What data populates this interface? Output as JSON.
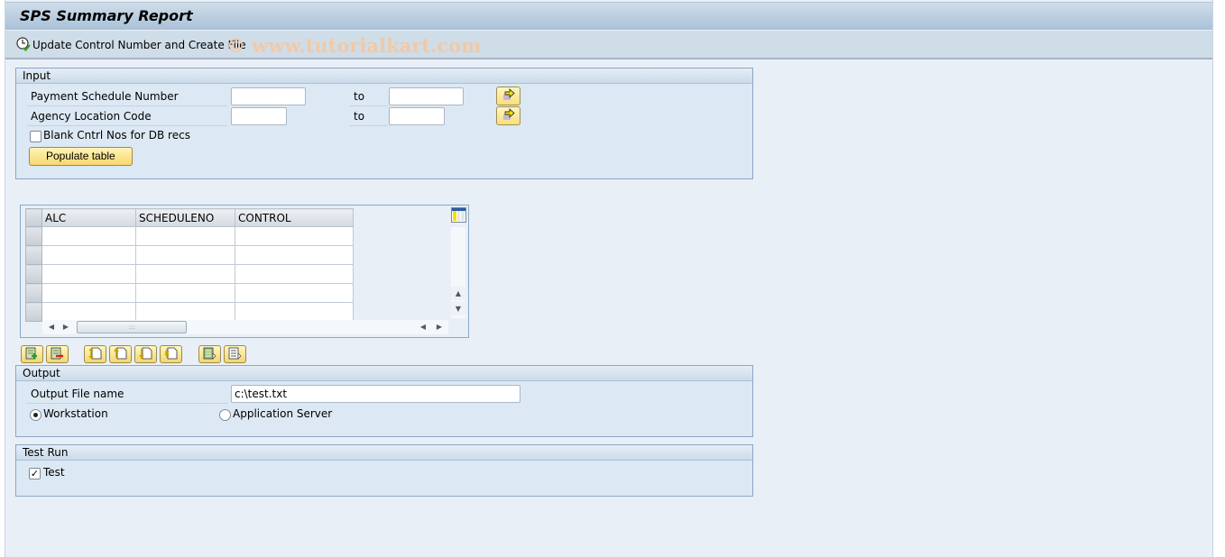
{
  "window": {
    "title": "SPS Summary Report"
  },
  "toolbar": {
    "execute_label": "Update Control Number and Create File",
    "execute_icon": "execute-clock-check-icon",
    "watermark": "© www.tutorialkart.com"
  },
  "input_group": {
    "title": "Input",
    "rows": [
      {
        "label": "Payment Schedule Number",
        "from_value": "",
        "to_label": "to",
        "to_value": "",
        "multi_icon": "multiple-selection-arrow-icon"
      },
      {
        "label": "Agency Location Code",
        "from_value": "",
        "to_label": "to",
        "to_value": "",
        "multi_icon": "multiple-selection-arrow-icon"
      }
    ],
    "blank_checkbox": {
      "label": "Blank Cntrl Nos for DB recs",
      "checked": false
    },
    "populate_button": "Populate table"
  },
  "grid": {
    "columns": [
      "ALC",
      "SCHEDULENO",
      "CONTROL"
    ],
    "rows": [
      [
        "",
        "",
        ""
      ],
      [
        "",
        "",
        ""
      ],
      [
        "",
        "",
        ""
      ],
      [
        "",
        "",
        ""
      ],
      [
        "",
        "",
        ""
      ]
    ],
    "toolbar_buttons": [
      {
        "name": "append-row-button",
        "icon": "append-row-icon"
      },
      {
        "name": "delete-row-button",
        "icon": "delete-row-icon"
      },
      {
        "name": "scroll-first-button",
        "icon": "first-page-icon"
      },
      {
        "name": "scroll-prev-button",
        "icon": "previous-page-icon"
      },
      {
        "name": "scroll-next-button",
        "icon": "next-page-icon"
      },
      {
        "name": "scroll-last-button",
        "icon": "last-page-icon"
      },
      {
        "name": "select-all-button",
        "icon": "select-all-icon"
      },
      {
        "name": "deselect-all-button",
        "icon": "deselect-all-icon"
      }
    ]
  },
  "output_group": {
    "title": "Output",
    "file_label": "Output File name",
    "file_value": "c:\\test.txt",
    "radio_workstation": {
      "label": "Workstation",
      "selected": true
    },
    "radio_appserver": {
      "label": "Application Server",
      "selected": false
    }
  },
  "testrun_group": {
    "title": "Test Run",
    "test_checkbox": {
      "label": "Test",
      "checked": true
    }
  },
  "colors": {
    "button_yellow": "#f8df7a",
    "frame_background": "#e8eff7",
    "group_border": "#8aa8c8"
  }
}
